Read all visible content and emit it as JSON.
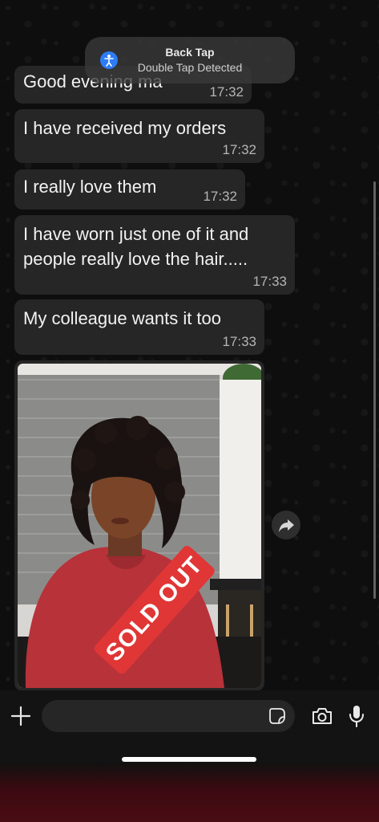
{
  "overlay": {
    "title": "Back Tap",
    "subtitle": "Double Tap Detected",
    "icon": "accessibility-icon"
  },
  "messages": [
    {
      "text": "Good evening ma",
      "time": "17:32"
    },
    {
      "text": "I have received my orders",
      "time": "17:32"
    },
    {
      "text": "I really love them",
      "time": "17:32"
    },
    {
      "text": "I have worn just one of it and\npeople really love the hair.....",
      "time": "17:33"
    },
    {
      "text": "My colleague wants it too",
      "time": "17:33"
    }
  ],
  "image_message": {
    "label": "SOLD OUT"
  },
  "composer": {
    "placeholder": "",
    "icons": [
      "plus-icon",
      "sticker-icon",
      "camera-icon",
      "microphone-icon"
    ]
  },
  "colors": {
    "bubble": "#262626",
    "label_red": "#e03636",
    "shirt_red": "#b8323a",
    "accent_blue": "#2c7cf6"
  }
}
